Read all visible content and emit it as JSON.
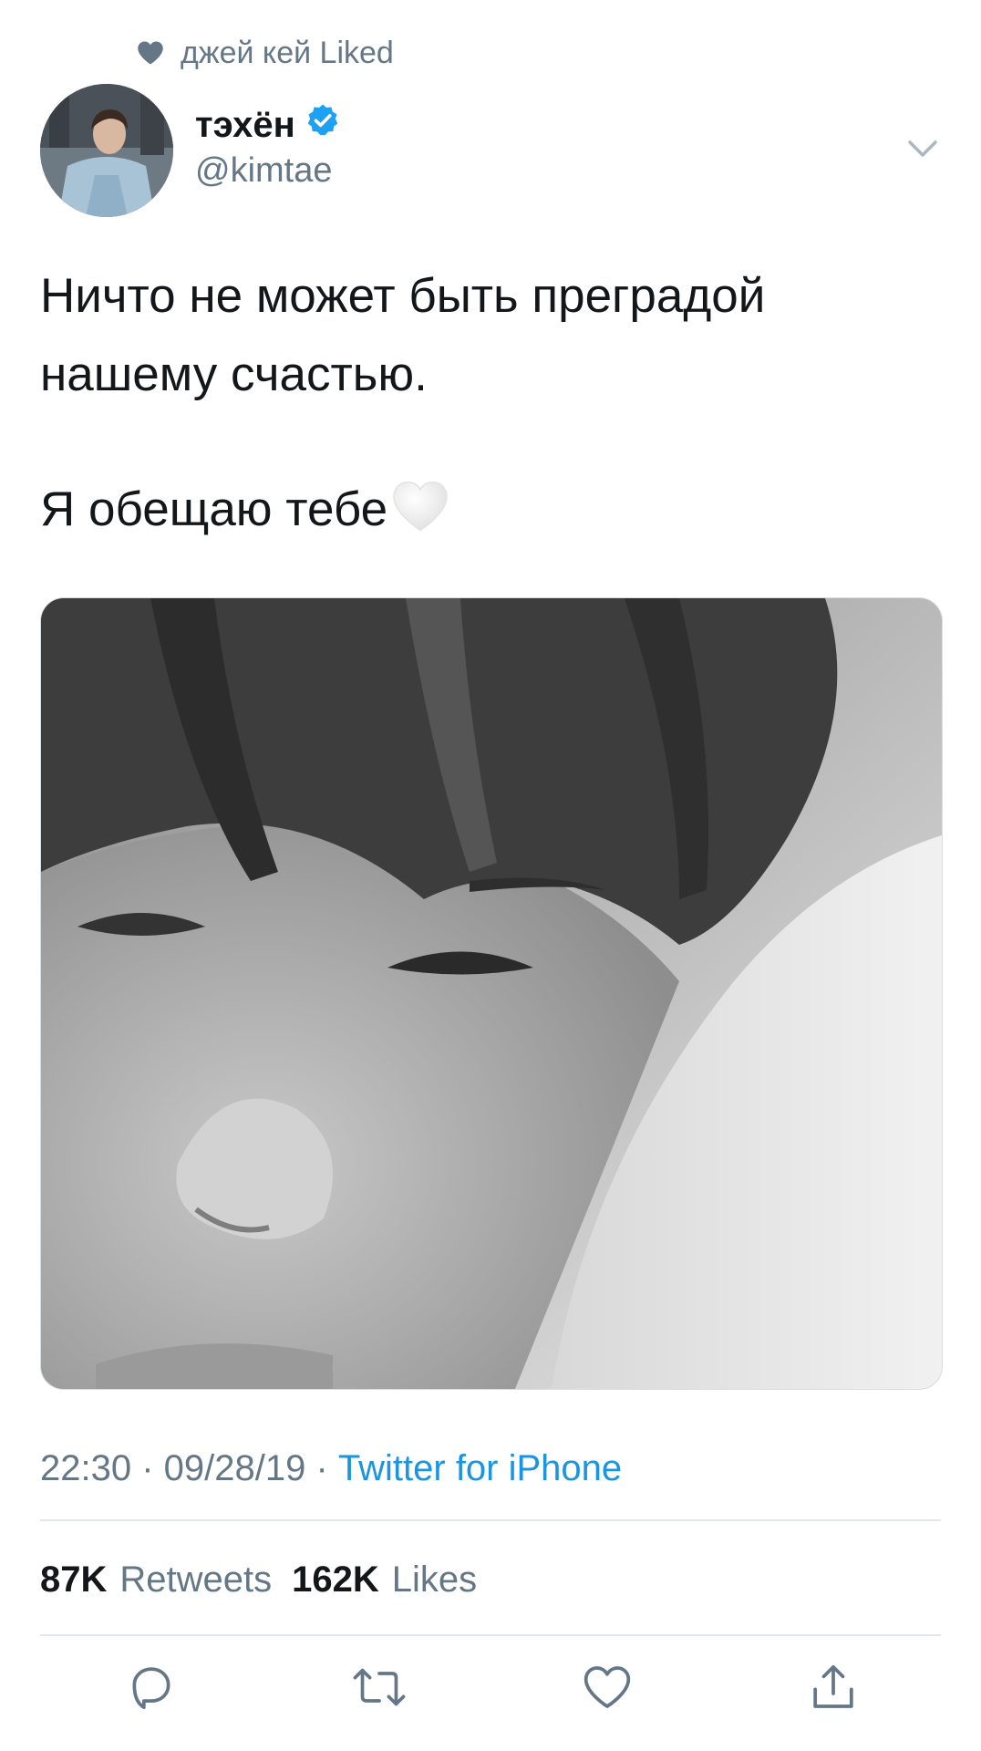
{
  "social_context": {
    "icon": "heart-icon",
    "text": "джей кей Liked"
  },
  "author": {
    "display_name": "тэхён",
    "handle": "@kimtae",
    "verified": true
  },
  "tweet": {
    "line1": "Ничто не может быть преградой",
    "line2": "нашему счастью.",
    "line3": "Я обещаю тебе",
    "emoji": "white-heart"
  },
  "meta": {
    "time": "22:30",
    "separator": " · ",
    "date": "09/28/19",
    "source": "Twitter for iPhone"
  },
  "stats": {
    "retweets_count": "87K",
    "retweets_label": "Retweets",
    "likes_count": "162K",
    "likes_label": "Likes"
  },
  "actions": [
    "reply-icon",
    "retweet-icon",
    "like-icon",
    "share-icon"
  ],
  "colors": {
    "text": "#14171a",
    "secondary": "#657786",
    "link": "#1b95e0",
    "verified": "#1da1f2",
    "divider": "#e1e8ed"
  }
}
